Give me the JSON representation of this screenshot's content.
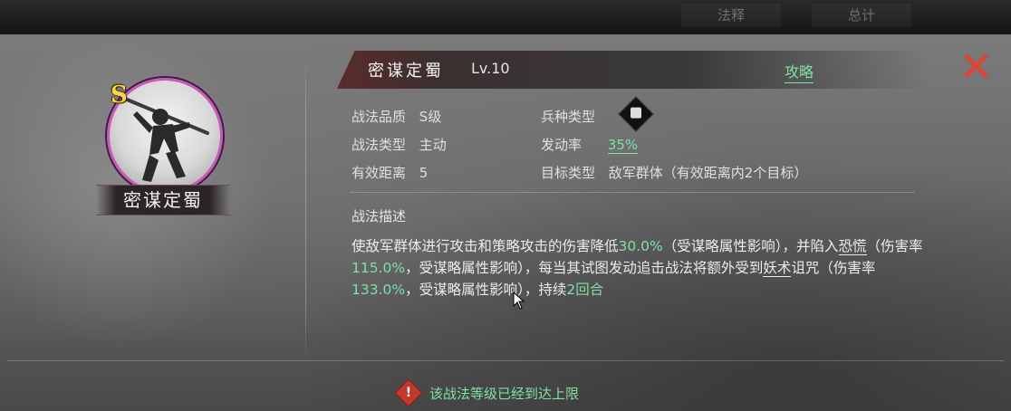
{
  "top_tabs": [
    "法释",
    "总计"
  ],
  "portrait": {
    "grade_badge": "S",
    "name_plate": "密谋定蜀",
    "ring_color": "#c55ab7"
  },
  "header": {
    "skill_name": "密谋定蜀",
    "level": "Lv.10",
    "guide_link": "攻略",
    "close_icon": "close-icon"
  },
  "attributes": {
    "quality_label": "战法品质",
    "quality_value": "S级",
    "type_label": "战法类型",
    "type_value": "主动",
    "range_label": "有效距离",
    "range_value": "5",
    "troop_label": "兵种类型",
    "troop_icon": "troop-type-icon",
    "rate_label": "发动率",
    "rate_value": "35%",
    "target_label": "目标类型",
    "target_value": "敌军群体（有效距离内2个目标）"
  },
  "description": {
    "title": "战法描述",
    "p1": "使敌军群体进行攻击和策略攻击的伤害降低",
    "v1": "30.0%",
    "p2": "（受谋略属性影响），并陷入",
    "term1": "恐慌",
    "p3": "（伤害率",
    "v2": "115.0%",
    "p4": "，受谋略属性影响），每当其试图发动追击战法将额外受到",
    "term2": "妖术",
    "p5": "诅咒（伤害率",
    "v3": "133.0%",
    "p6": "，受谋略属性影响），持续",
    "v4": "2回合"
  },
  "footer": {
    "warning_icon": "warning-icon",
    "warning_text": "该战法等级已经到达上限"
  },
  "colors": {
    "accent_green": "#7fe0a8",
    "close_red": "#d8463c",
    "grade_gold": "#f7d447"
  }
}
